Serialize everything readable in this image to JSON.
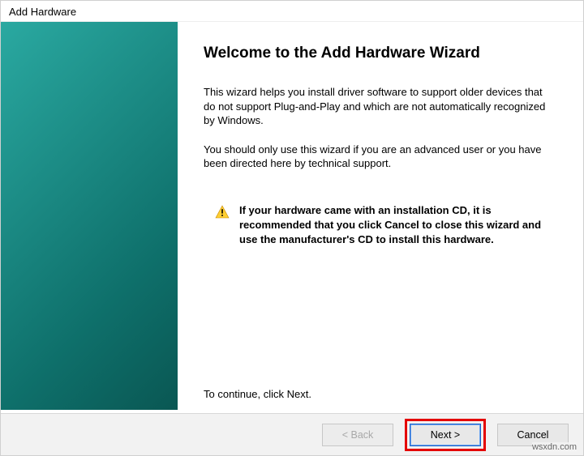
{
  "window": {
    "title": "Add Hardware"
  },
  "main": {
    "heading": "Welcome to the Add Hardware Wizard",
    "paragraph1": "This wizard helps you install driver software to support older devices that do not support Plug-and-Play and which are not automatically recognized by Windows.",
    "paragraph2": "You should only use this wizard if you are an advanced user or you have been directed here by technical support.",
    "notice": "If your hardware came with an installation CD, it is recommended that you click Cancel to close this wizard and use the manufacturer's CD to install this hardware.",
    "continue": "To continue, click Next."
  },
  "buttons": {
    "back": "< Back",
    "next": "Next >",
    "cancel": "Cancel"
  },
  "watermark": "wsxdn.com"
}
